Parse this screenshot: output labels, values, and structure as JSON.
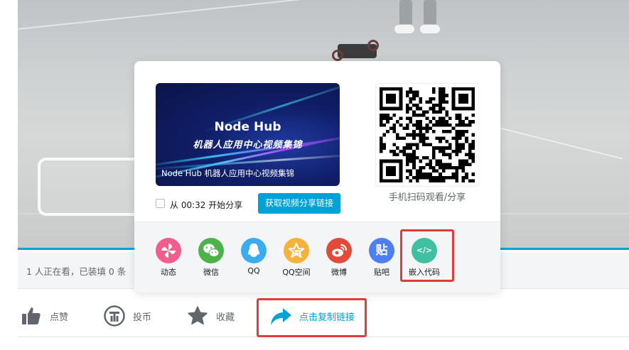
{
  "video": {
    "viewers_text": "1 人正在看，已装填 0 条"
  },
  "share_popup": {
    "thumbnail": {
      "title": "Node Hub",
      "subtitle": "机器人应用中心视频集锦",
      "caption": "Node Hub 机器人应用中心视频集锦"
    },
    "share_from_label": "从 00:32 开始分享",
    "share_from_checked": false,
    "get_link_button": "获取视频分享链接",
    "qr_label": "手机扫码观看/分享",
    "platforms": [
      {
        "label": "动态",
        "icon": "pinwheel-icon",
        "color": "#f25d8e"
      },
      {
        "label": "微信",
        "icon": "wechat-icon",
        "color": "#4bb34a"
      },
      {
        "label": "QQ",
        "icon": "qq-icon",
        "color": "#3aadf2"
      },
      {
        "label": "QQ空间",
        "icon": "qzone-icon",
        "color": "#f6b33c"
      },
      {
        "label": "微博",
        "icon": "weibo-icon",
        "color": "#e04b3a"
      },
      {
        "label": "贴吧",
        "icon": "tieba-icon",
        "color": "#4e7ef0",
        "glyph": "贴"
      },
      {
        "label": "嵌入代码",
        "icon": "embed-code-icon",
        "color": "#3fc0a0",
        "glyph": "</>"
      }
    ]
  },
  "actions": {
    "like": "点赞",
    "coin": "投币",
    "favorite": "收藏",
    "copy_link": "点击复制链接"
  },
  "colors": {
    "accent": "#00a1d6",
    "highlight": "#e03b3b"
  }
}
